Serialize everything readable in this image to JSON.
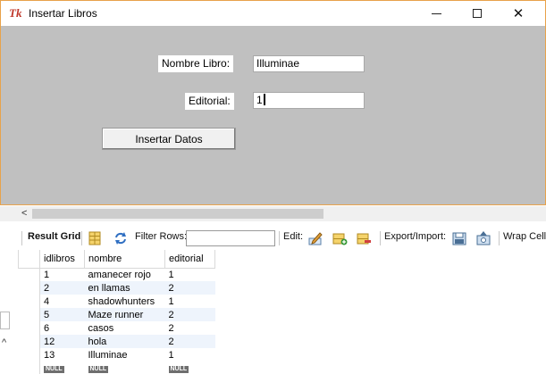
{
  "window": {
    "logo_text": "Tk",
    "title": "Insertar Libros",
    "minimize_glyph": "—",
    "maximize_glyph": "☐",
    "close_glyph": "✕"
  },
  "form": {
    "nombre_label": "Nombre Libro:",
    "nombre_value": "Illuminae",
    "editorial_label": "Editorial:",
    "editorial_value": "1",
    "submit_label": "Insertar Datos"
  },
  "toolbar": {
    "result_grid_label": "Result Grid",
    "filter_rows_label": "Filter Rows:",
    "filter_rows_value": "",
    "edit_label": "Edit:",
    "export_import_label": "Export/Import:",
    "wrap_cell_label": "Wrap Cell"
  },
  "grid": {
    "headers": [
      "idlibros",
      "nombre",
      "editorial"
    ],
    "rows": [
      [
        "1",
        "amanecer rojo",
        "1"
      ],
      [
        "2",
        "en llamas",
        "2"
      ],
      [
        "4",
        "shadowhunters",
        "1"
      ],
      [
        "5",
        "Maze runner",
        "2"
      ],
      [
        "6",
        "casos",
        "2"
      ],
      [
        "12",
        "hola",
        "2"
      ],
      [
        "13",
        "Illuminae",
        "1"
      ]
    ],
    "null_label": "NULL"
  },
  "colors": {
    "window_bg": "#c0c0c0",
    "window_border": "#e8a24a",
    "alt_row": "#eef4fc",
    "null_badge": "#6e6e6e"
  },
  "icons": [
    "tk-logo-icon",
    "grid-icon",
    "refresh-icon",
    "edit-pencil-icon",
    "add-row-icon",
    "delete-row-icon",
    "export-icon",
    "import-icon",
    "scroll-left-icon"
  ]
}
